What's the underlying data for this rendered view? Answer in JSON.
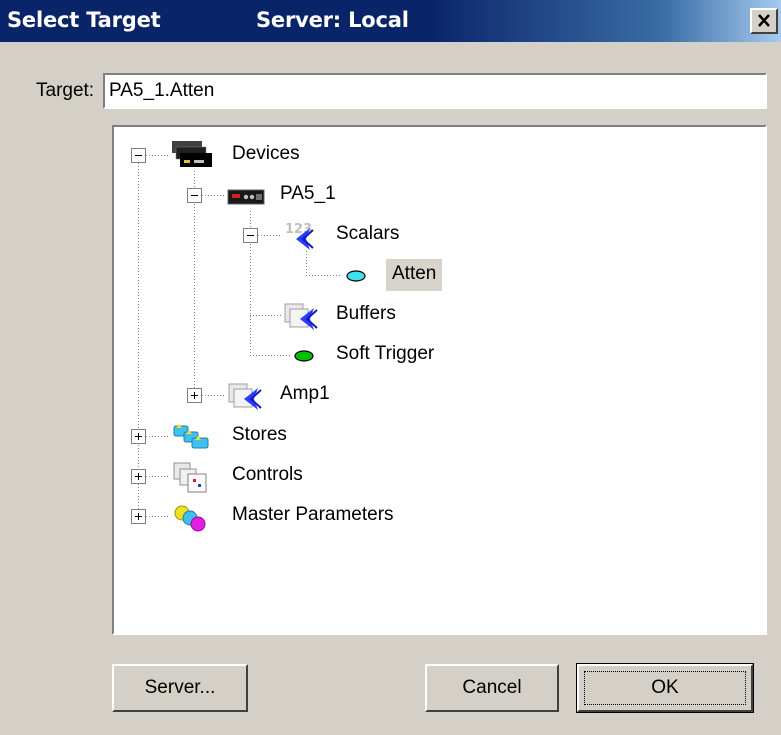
{
  "dialog": {
    "title": "Select Target",
    "server_text": "Server: Local",
    "close_glyph": "✕"
  },
  "target": {
    "label": "Target:",
    "value": "PA5_1.Atten"
  },
  "tree": {
    "devices": "Devices",
    "pa5_1": "PA5_1",
    "scalars": "Scalars",
    "scalars_badge": "123",
    "atten": "Atten",
    "buffers": "Buffers",
    "soft_trigger": "Soft Trigger",
    "amp1": "Amp1",
    "stores": "Stores",
    "controls": "Controls",
    "master_parameters": "Master Parameters",
    "selected_item": "Atten"
  },
  "buttons": {
    "server": "Server...",
    "cancel": "Cancel",
    "ok": "OK"
  },
  "icons": {
    "devices": "devices-stack-icon",
    "device": "device-rack-icon",
    "scalars": "scalars-icon",
    "buffers": "buffers-icon",
    "amp": "amp-icon",
    "stores": "stores-icon",
    "controls": "controls-icon",
    "master": "master-parameters-icon",
    "atten": "cyan-oval-icon",
    "soft_trigger": "green-oval-icon"
  },
  "colors": {
    "titlebar_start": "#0a246a",
    "titlebar_end": "#a6caf0",
    "dialog_bg": "#d4d0c8",
    "atten_oval": "#40e0f0",
    "trigger_oval": "#00c000",
    "selection_bg": "#d8d4cc"
  }
}
